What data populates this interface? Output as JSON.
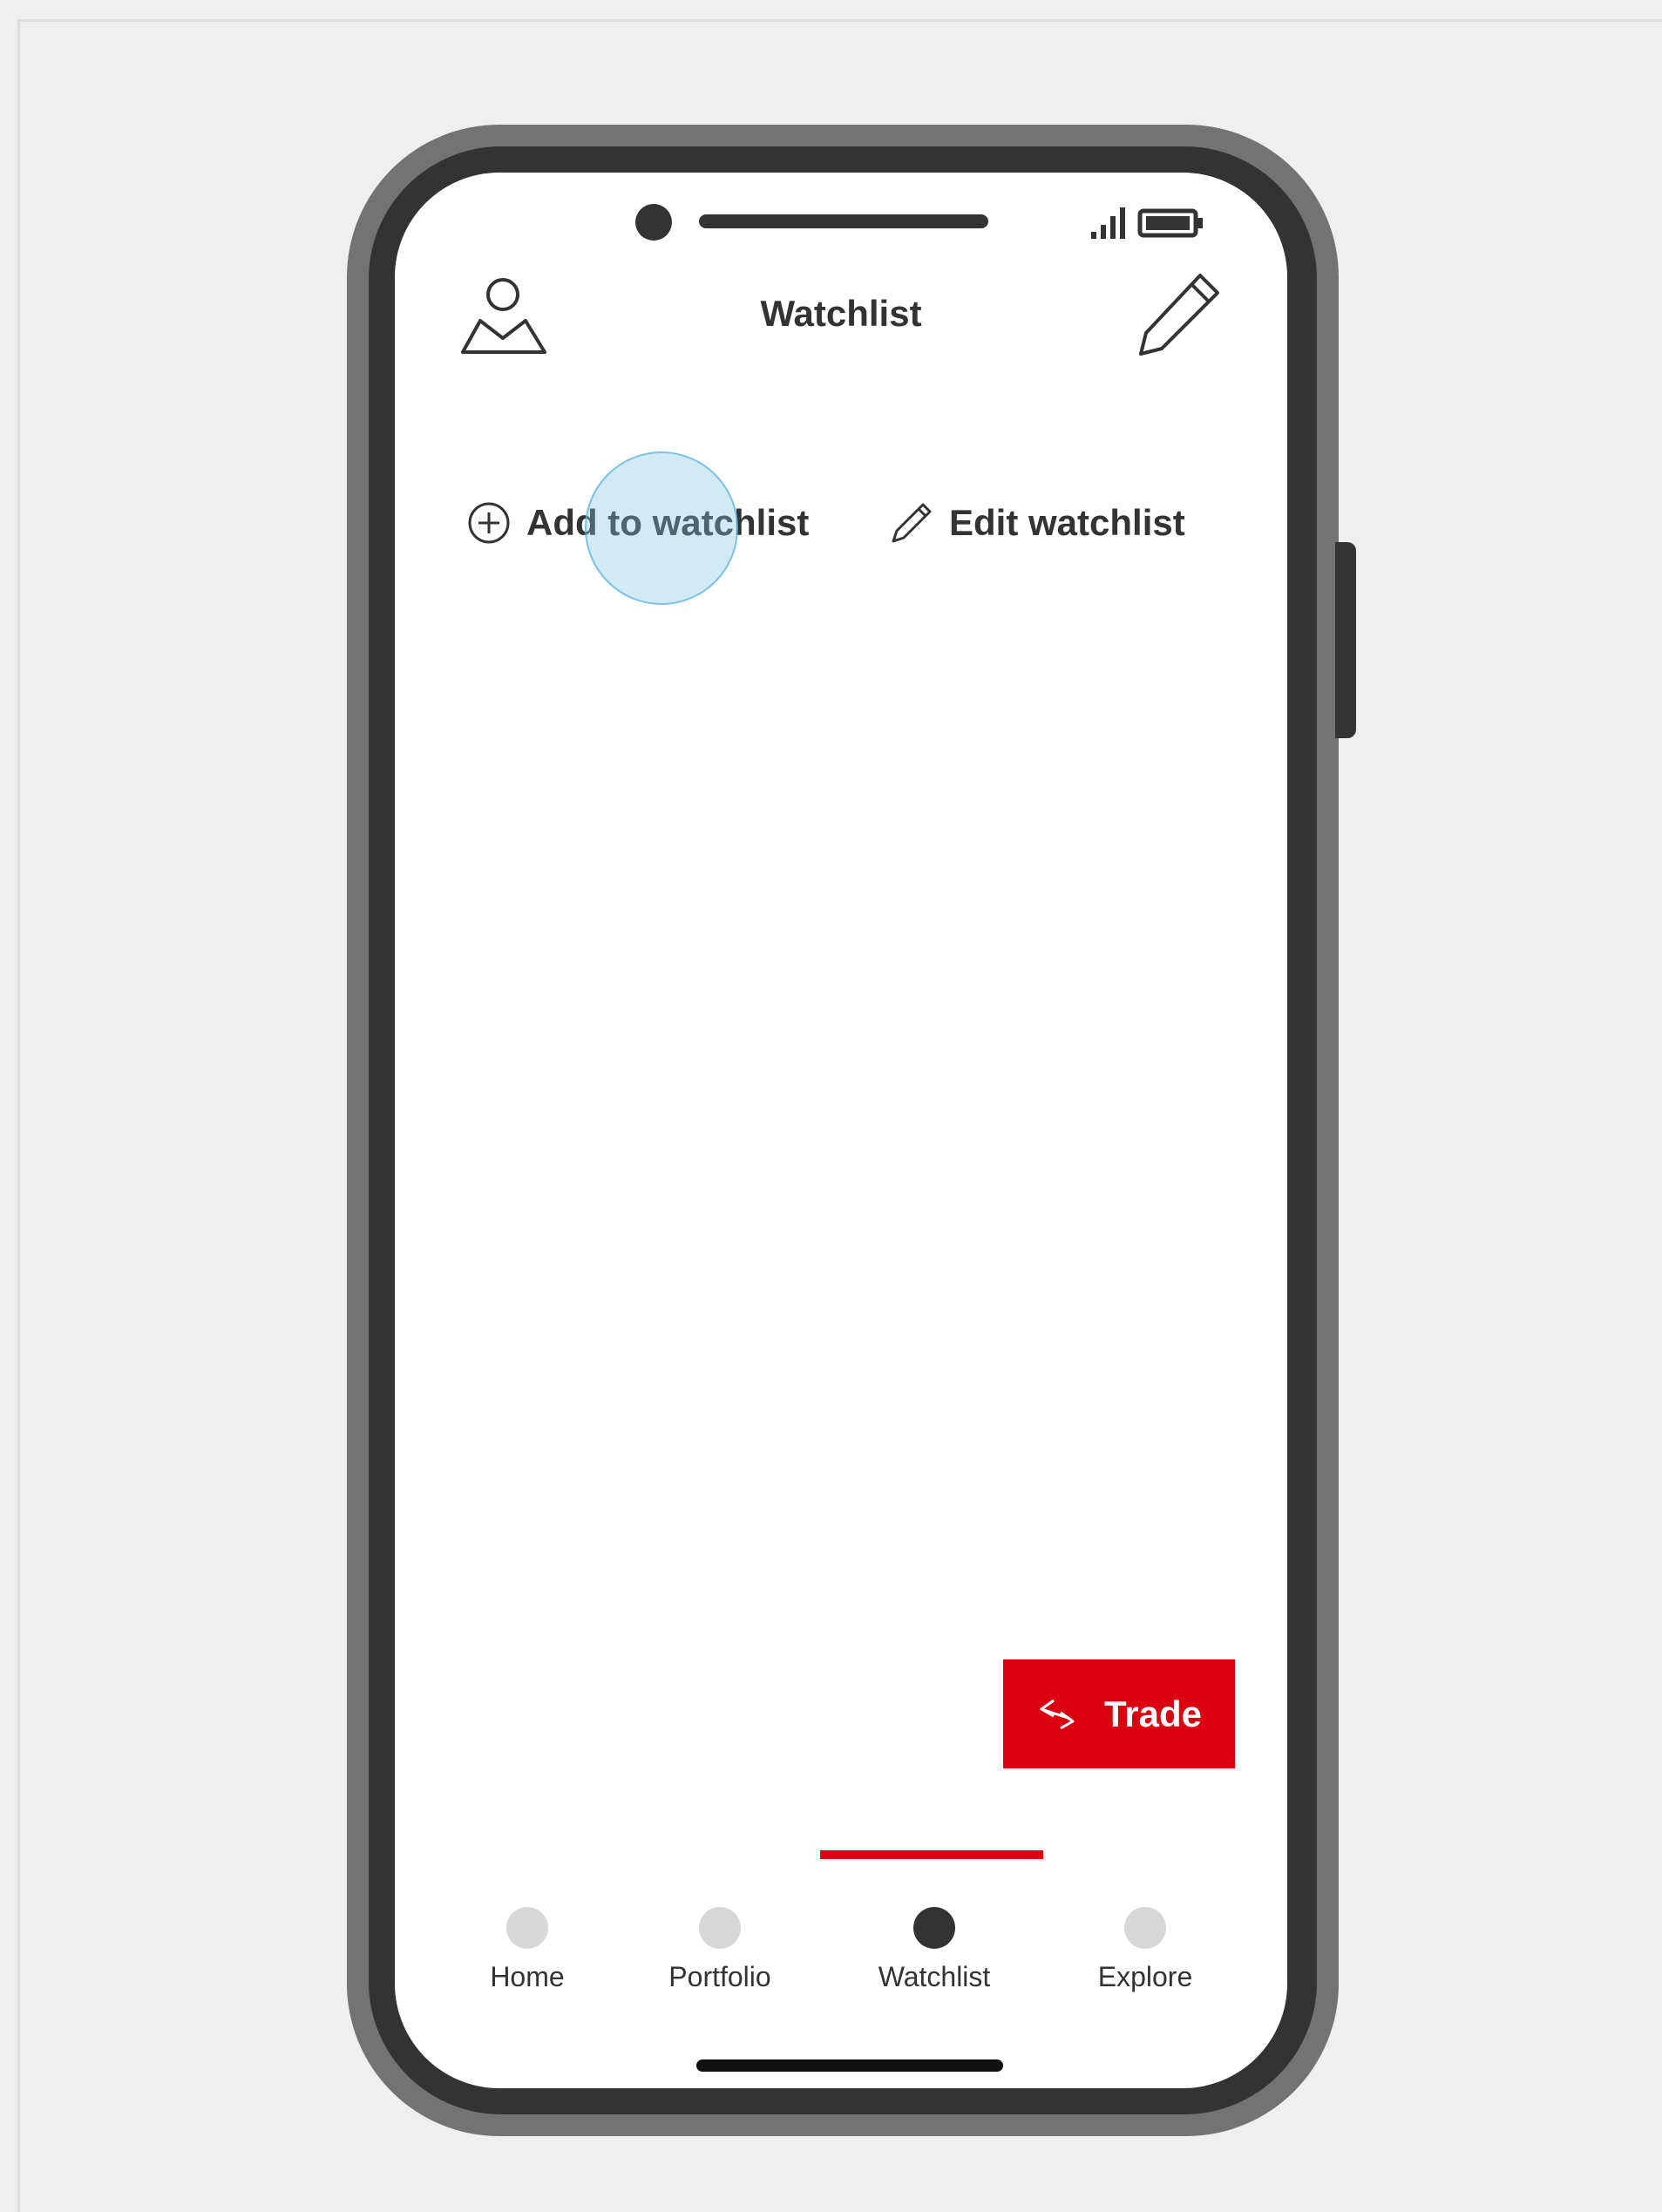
{
  "header": {
    "title": "Watchlist"
  },
  "actions": {
    "add_label": "Add to watchlist",
    "edit_label": "Edit watchlist"
  },
  "trade": {
    "label": "Trade"
  },
  "tabs": [
    {
      "label": "Home"
    },
    {
      "label": "Portfolio"
    },
    {
      "label": "Watchlist"
    },
    {
      "label": "Explore"
    }
  ],
  "active_tab": "Watchlist",
  "colors": {
    "accent": "#db0011",
    "text": "#333333",
    "frame": "#333333",
    "frame_outer": "#737373",
    "inactive_dot": "#d7d7d7",
    "background": "#efefef"
  },
  "icons": [
    "profile-icon",
    "pencil-icon",
    "plus-circle-icon",
    "edit-pencil-icon",
    "trade-arrows-icon",
    "signal-icon",
    "battery-icon"
  ]
}
